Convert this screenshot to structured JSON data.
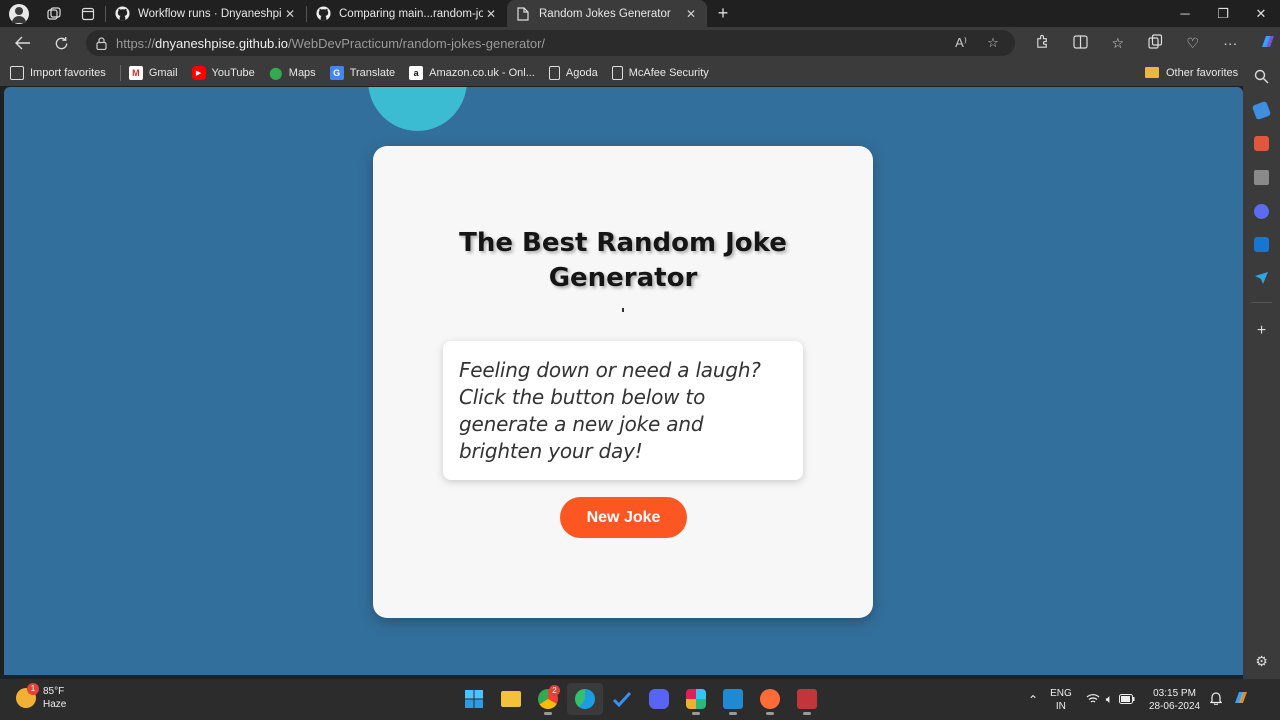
{
  "browser": {
    "tabs": [
      {
        "title": "Workflow runs · Dnyaneshpise/W",
        "icon": "github-icon",
        "active": false
      },
      {
        "title": "Comparing main...random-jokes",
        "icon": "github-icon",
        "active": false
      },
      {
        "title": "Random Jokes Generator",
        "icon": "page-icon",
        "active": true
      }
    ],
    "url_prefix": "https://",
    "url_host": "dnyaneshpise.github.io",
    "url_path": "/WebDevPracticum/random-jokes-generator/",
    "read_aloud": "A⁾"
  },
  "favorites": {
    "items": [
      {
        "label": "Import favorites",
        "icon": "import-icon"
      },
      {
        "label": "Gmail",
        "icon": "gmail-icon"
      },
      {
        "label": "YouTube",
        "icon": "youtube-icon"
      },
      {
        "label": "Maps",
        "icon": "maps-icon"
      },
      {
        "label": "Translate",
        "icon": "translate-icon"
      },
      {
        "label": "Amazon.co.uk - Onl...",
        "icon": "amazon-icon"
      },
      {
        "label": "Agoda",
        "icon": "page-icon"
      },
      {
        "label": "McAfee Security",
        "icon": "page-icon"
      }
    ],
    "other": "Other favorites"
  },
  "page": {
    "heading_line1": "The Best Random Joke",
    "heading_line2": "Generator",
    "joke_text": "Feeling down or need a laugh? Click the button below to generate a new joke and brighten your day!",
    "button_label": "New Joke",
    "colors": {
      "background": "#336f9c",
      "card": "#f7f7f7",
      "circle": "#3cbcd3",
      "button": "#fc5722"
    }
  },
  "taskbar": {
    "weather_temp": "85°F",
    "weather_desc": "Haze",
    "weather_badge": "1",
    "lang_line1": "ENG",
    "lang_line2": "IN",
    "time": "03:15 PM",
    "date": "28-06-2024",
    "chrome_badge": "2"
  }
}
